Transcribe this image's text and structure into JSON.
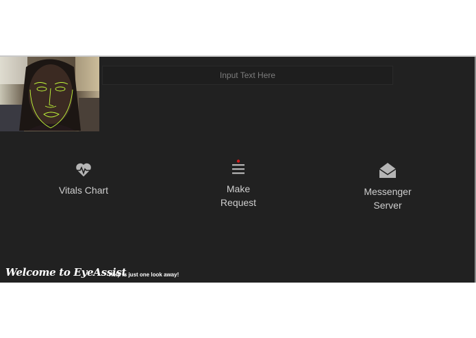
{
  "search": {
    "placeholder": "Input Text Here"
  },
  "actions": [
    {
      "icon": "heartbeat-icon",
      "line1": "Vitals Chart",
      "line2": ""
    },
    {
      "icon": "menu-lines-icon",
      "line1": "Make",
      "line2": "Request"
    },
    {
      "icon": "open-envelope-icon",
      "line1": "Messenger",
      "line2": "Server"
    }
  ],
  "footer": {
    "title": "Welcome to EyeAssist",
    "tagline": "Help is just one look away!"
  },
  "colors": {
    "background": "#212121",
    "icon": "#b5b5b5",
    "text": "#cfcfcf",
    "notification_dot": "#d11a1a",
    "face_mesh": "#c6ff3a"
  }
}
